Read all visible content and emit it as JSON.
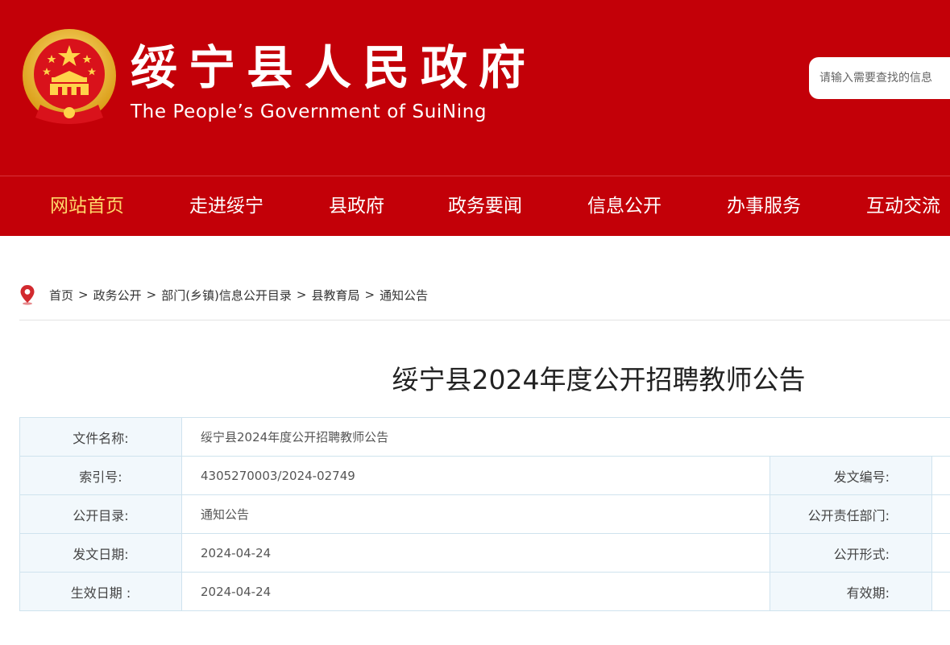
{
  "header": {
    "title": "绥宁县人民政府",
    "subtitle": "The People’s Government of SuiNing",
    "search_placeholder": "请输入需要查找的信息",
    "brand_color": "#c30008",
    "emblem_icon": "national-emblem-icon"
  },
  "nav": {
    "items": [
      {
        "label": "网站首页",
        "active": true
      },
      {
        "label": "走进绥宁",
        "active": false
      },
      {
        "label": "县政府",
        "active": false
      },
      {
        "label": "政务要闻",
        "active": false
      },
      {
        "label": "信息公开",
        "active": false
      },
      {
        "label": "办事服务",
        "active": false
      },
      {
        "label": "互动交流",
        "active": false
      }
    ],
    "active_color": "#ffd86b"
  },
  "breadcrumb": {
    "icon": "location-pin-icon",
    "separator": ">",
    "items": [
      "首页",
      "政务公开",
      "部门(乡镇)信息公开目录",
      "县教育局",
      "通知公告"
    ]
  },
  "article": {
    "title": "绥宁县2024年度公开招聘教师公告"
  },
  "info_table": {
    "file_name_label": "文件名称:",
    "file_name_value": "绥宁县2024年度公开招聘教师公告",
    "rows": [
      {
        "label": "索引号:",
        "value": "4305270003/2024-02749",
        "label2": "发文编号:",
        "value2": ""
      },
      {
        "label": "公开目录:",
        "value": "通知公告",
        "label2": "公开责任部门:",
        "value2": ""
      },
      {
        "label": "发文日期:",
        "value": "2024-04-24",
        "label2": "公开形式:",
        "value2": ""
      },
      {
        "label": "生效日期 :",
        "value": "2024-04-24",
        "label2": "有效期:",
        "value2": ""
      }
    ]
  }
}
